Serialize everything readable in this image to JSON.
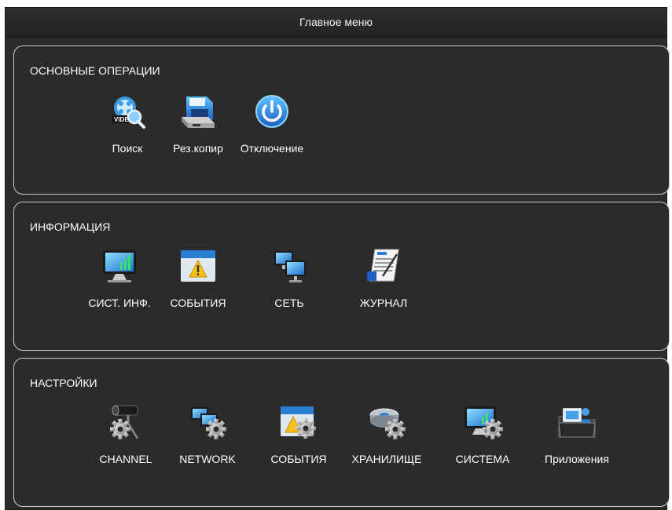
{
  "window": {
    "title": "Главное меню"
  },
  "sections": [
    {
      "title": "ОСНОВНЫЕ ОПЕРАЦИИ",
      "items": [
        {
          "label": "Поиск",
          "icon": "video-search-icon"
        },
        {
          "label": "Рез.копир",
          "icon": "backup-drive-icon"
        },
        {
          "label": "Отключение",
          "icon": "power-icon"
        }
      ]
    },
    {
      "title": "ИНФОРМАЦИЯ",
      "items": [
        {
          "label": "СИСТ. ИНФ.",
          "icon": "system-info-monitor-icon"
        },
        {
          "label": "СОБЫТИЯ",
          "icon": "event-warning-icon"
        },
        {
          "label": "СЕТЬ",
          "icon": "network-monitors-icon"
        },
        {
          "label": "ЖУРНАЛ",
          "icon": "log-document-icon"
        }
      ]
    },
    {
      "title": "НАСТРОЙКИ",
      "items": [
        {
          "label": "CHANNEL",
          "icon": "camera-gear-icon"
        },
        {
          "label": "NETWORK",
          "icon": "network-gear-icon"
        },
        {
          "label": "СОБЫТИЯ",
          "icon": "event-gear-icon"
        },
        {
          "label": "ХРАНИЛИЩЕ",
          "icon": "storage-gear-icon"
        },
        {
          "label": "СИСТЕМА",
          "icon": "system-gear-icon"
        },
        {
          "label": "Приложения",
          "icon": "apps-folder-icon"
        }
      ]
    }
  ]
}
